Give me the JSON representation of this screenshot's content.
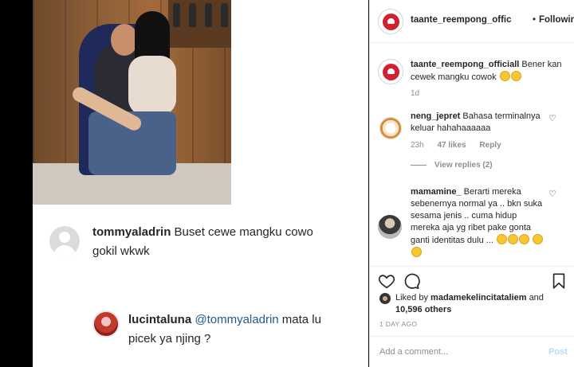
{
  "post": {
    "image": {
      "comment_1": {
        "username": "tommyaladrin",
        "text": "Buset cewe mangku cowo gokil wkwk"
      },
      "comment_2": {
        "username": "lucintaluna",
        "mention": "@tommyaladrin",
        "text": "mata lu picek ya njing ?"
      }
    },
    "header": {
      "username": "taante_reempong_offic",
      "separator": "•",
      "follow_label": "Following"
    },
    "caption": {
      "username": "taante_reempong_officiall",
      "text": "Bener kan cewek mangku cowok",
      "emoji": [
        "😅",
        "😅"
      ],
      "age": "1d"
    },
    "comments": [
      {
        "username": "neng_jepret",
        "text": "Bahasa terminalnya keluar hahahaaaaaa",
        "age": "23h",
        "likes": "47 likes",
        "reply_label": "Reply",
        "view_replies": "View replies (2)"
      },
      {
        "username": "mamamine_",
        "text": "Berarti mereka sebenernya normal ya .. bkn suka sesama jenis .. cuma hidup mereka aja yg ribet pake gonta ganti identitas dulu ...",
        "emoji": [
          "🤣",
          "🤣",
          "🤣",
          "🤣",
          "🤣"
        ]
      }
    ],
    "liked_by": {
      "prefix": "Liked by",
      "user": "madamekelincitataliem",
      "and": "and",
      "count": "10,596 others"
    },
    "date": "1 DAY AGO",
    "add_comment": {
      "placeholder": "Add a comment...",
      "post_label": "Post"
    }
  },
  "icons": [
    "heart-icon",
    "comment-icon",
    "bookmark-icon"
  ]
}
